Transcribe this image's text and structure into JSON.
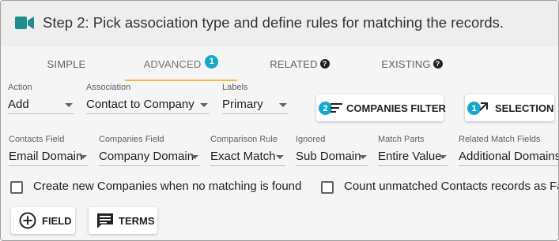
{
  "header": {
    "title": "Step 2: Pick association type and define rules for matching the records.",
    "icon": "video-camera-icon"
  },
  "tabs": [
    {
      "label": "SIMPLE"
    },
    {
      "label": "ADVANCED",
      "badge": "1"
    },
    {
      "label": "RELATED",
      "help": "?"
    },
    {
      "label": "EXISTING",
      "help": "?"
    }
  ],
  "row1": {
    "action": {
      "label": "Action",
      "value": "Add"
    },
    "association": {
      "label": "Association",
      "value": "Contact to Company"
    },
    "labels": {
      "label": "Labels",
      "value": "Primary"
    },
    "companies_filter": {
      "label": "COMPANIES FILTER",
      "badge": "2"
    },
    "selection": {
      "label": "SELECTION",
      "badge": "1"
    }
  },
  "row2": {
    "contacts_field": {
      "label": "Contacts Field",
      "value": "Email Domain"
    },
    "companies_field": {
      "label": "Companies Field",
      "value": "Company Domain"
    },
    "comparison_rule": {
      "label": "Comparison Rule",
      "value": "Exact Match"
    },
    "ignored": {
      "label": "Ignored",
      "value": "Sub Domain"
    },
    "match_parts": {
      "label": "Match Parts",
      "value": "Entire Value"
    },
    "related_match": {
      "label": "Related Match Fields",
      "value": "Additional Domains"
    }
  },
  "checkboxes": {
    "create_new": "Create new Companies when no matching is found",
    "count_unmatched": "Count unmatched Contacts records as Fail"
  },
  "buttons": {
    "field": "FIELD",
    "terms": "TERMS"
  },
  "colors": {
    "accent": "#17a7c9",
    "tab_underline": "#f5b841",
    "camera": "#1e8e8a"
  }
}
